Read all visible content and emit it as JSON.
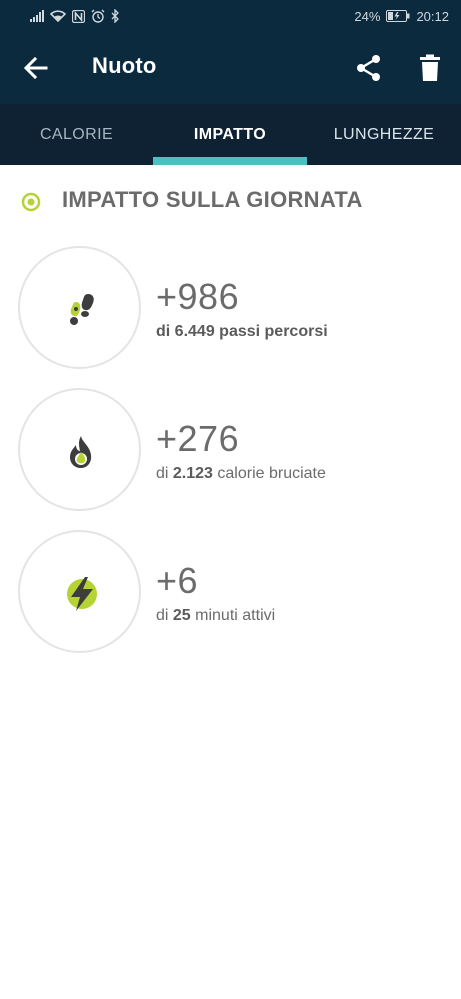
{
  "status_bar": {
    "battery": "24%",
    "time": "20:12"
  },
  "app_bar": {
    "title": "Nuoto"
  },
  "tabs": [
    {
      "label": "CALORIE",
      "selected": false
    },
    {
      "label": "IMPATTO",
      "selected": true
    },
    {
      "label": "LUNGHEZZE",
      "selected": false
    }
  ],
  "section": {
    "title": "IMPATTO SULLA GIORNATA"
  },
  "metrics": [
    {
      "icon": "footprint-icon",
      "value": "+986",
      "prefix": "di ",
      "amount": "6.449",
      "suffix": " passi percorsi"
    },
    {
      "icon": "flame-icon",
      "value": "+276",
      "prefix": "di ",
      "amount": "2.123",
      "suffix": " calorie bruciate"
    },
    {
      "icon": "lightning-icon",
      "value": "+6",
      "prefix": "di ",
      "amount": "25",
      "suffix": " minuti attivi"
    }
  ],
  "colors": {
    "header_bg": "#0c2a3d",
    "tab_bg": "#0e2233",
    "tab_indicator": "#4bc0c0",
    "accent_green": "#b5d335",
    "text_gray": "#6b6b6b"
  }
}
